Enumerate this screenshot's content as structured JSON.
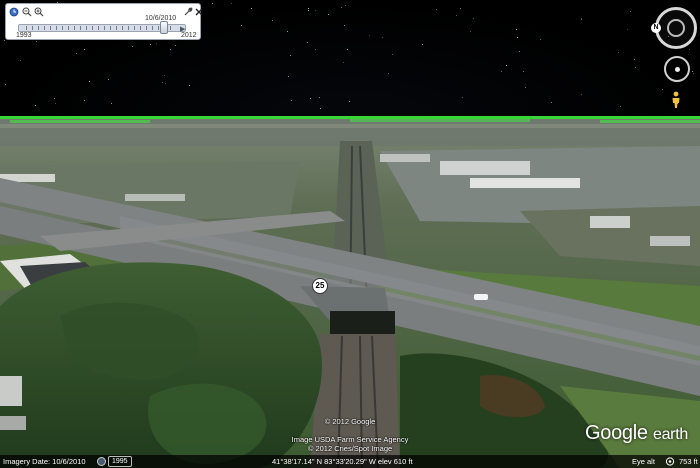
{
  "time_slider": {
    "current_date": "10/6/2010",
    "start_year": "1993",
    "end_year": "2012",
    "icons": [
      "clock-icon",
      "zoom-out-icon",
      "zoom-in-icon",
      "wrench-icon",
      "close-icon"
    ]
  },
  "navigation": {
    "north_label": "N"
  },
  "map": {
    "route_shield": "25"
  },
  "attribution": {
    "line1": "© 2012 Google",
    "line2": "Image USDA Farm Service Agency",
    "line3": "© 2012 Cnes/Spot Image"
  },
  "branding": {
    "word1": "Google",
    "word2": "earth"
  },
  "status_bar": {
    "imagery_date": "Imagery Date: 10/6/2010",
    "historical_year": "1995",
    "coordinates": "41°38'17.14\" N   83°33'20.29\" W  elev  610 ft",
    "eye_alt_label": "Eye alt",
    "eye_alt_value": "753 ft"
  },
  "colors": {
    "sky": "#000000",
    "horizon_glow": "#1eff1e",
    "road": "#7c7f80",
    "grass": "#4c6b34",
    "trees": "#2a4a23"
  }
}
